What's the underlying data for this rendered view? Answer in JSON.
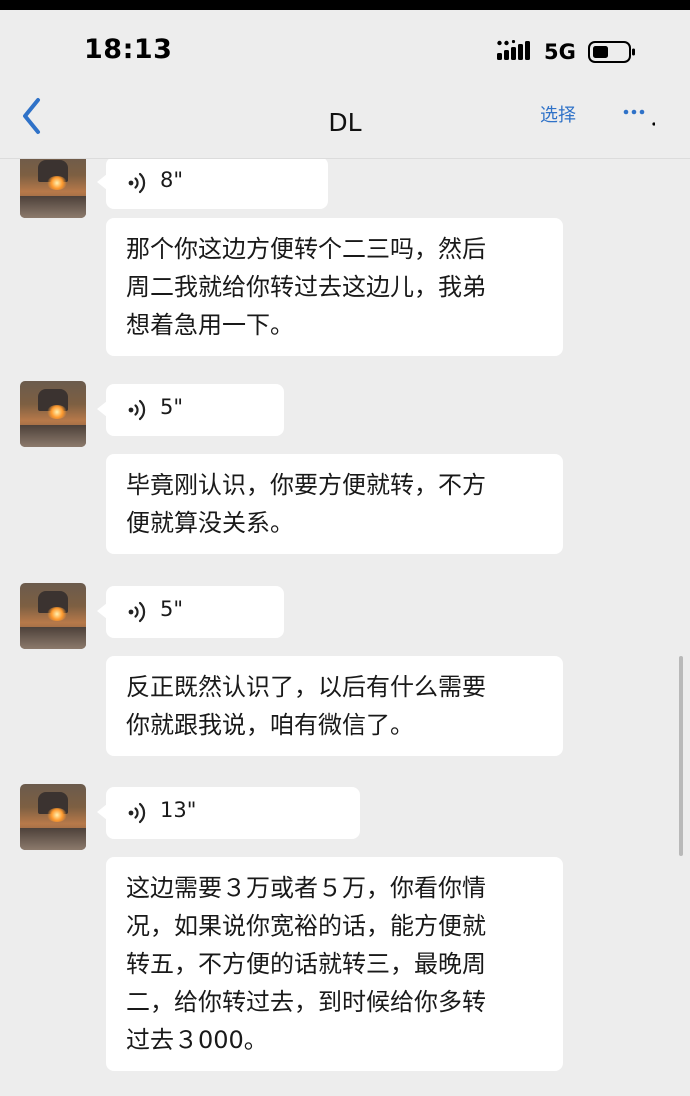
{
  "status_bar": {
    "time": "18:13",
    "network": "5G"
  },
  "nav": {
    "title": "DL",
    "select_label": "选择"
  },
  "messages": [
    {
      "voice_duration": "8\"",
      "text_lines": [
        "那个你这边方便转个二三吗，然后",
        "周二我就给你转过去这边儿，我弟",
        "想着急用一下。"
      ]
    },
    {
      "voice_duration": "5\"",
      "text_lines": [
        "毕竟刚认识，你要方便就转，不方",
        "便就算没关系。"
      ]
    },
    {
      "voice_duration": "5\"",
      "text_lines": [
        "反正既然认识了，以后有什么需要",
        "你就跟我说，咱有微信了。"
      ]
    },
    {
      "voice_duration": "13\"",
      "text_lines": [
        "这边需要３万或者５万，你看你情",
        "况，如果说你宽裕的话，能方便就",
        "转五，不方便的话就转三，最晚周",
        "二，给你转过去，到时候给你多转",
        "过去３000。"
      ]
    }
  ],
  "icons": {
    "back": "chevron-left-icon",
    "more": "more-dots-icon",
    "signal": "cellular-signal-icon",
    "battery": "battery-icon",
    "voice": "voice-wave-icon"
  },
  "colors": {
    "background": "#ededed",
    "bubble": "#ffffff",
    "accent": "#2f72c8"
  }
}
